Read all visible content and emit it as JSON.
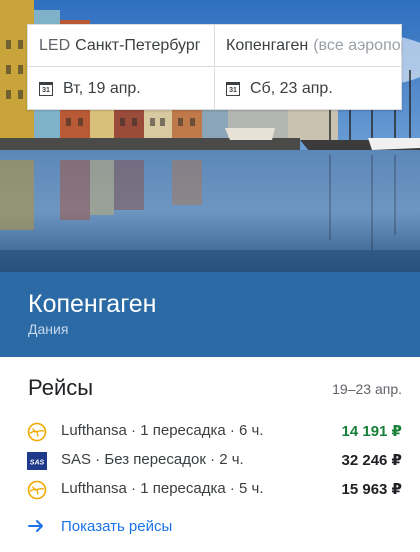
{
  "search": {
    "origin_code": "LED",
    "origin_city": "Санкт-Петербург",
    "destination_city": "Копенгаген",
    "destination_hint": "(все аэропорты)",
    "depart_date": "Вт, 19 апр.",
    "return_date": "Сб, 23 апр.",
    "calendar_icon_text": "31"
  },
  "destination": {
    "city": "Копенгаген",
    "country": "Дания",
    "banner_color": "#2c6aa6"
  },
  "flights": {
    "title": "Рейсы",
    "dates": "19–23 апр.",
    "items": [
      {
        "airline": "Lufthansa",
        "details": "Lufthansa · 1 пересадка · 6 ч.",
        "price": "14 191 ₽",
        "best": true,
        "logo_icon": "lufthansa-crane-icon"
      },
      {
        "airline": "SAS",
        "details": "SAS · Без пересадок · 2 ч.",
        "price": "32 246 ₽",
        "best": false,
        "logo_icon": "sas-logo-icon"
      },
      {
        "airline": "Lufthansa",
        "details": "Lufthansa · 1 пересадка · 5 ч.",
        "price": "15 963 ₽",
        "best": false,
        "logo_icon": "lufthansa-crane-icon"
      }
    ],
    "show_label": "Показать рейсы"
  },
  "colors": {
    "best_price": "#188038",
    "link": "#1a73e8",
    "lufthansa": "#f2a900",
    "sas": "#1f3a8a"
  }
}
